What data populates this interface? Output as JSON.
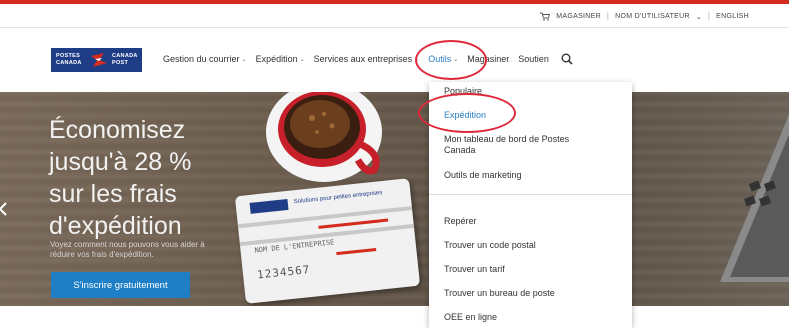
{
  "utility": {
    "shop": "MAGASINER",
    "username": "NOM D'UTILISATEUR",
    "username_caret": "⌄",
    "language": "ENGLISH",
    "separator": "|"
  },
  "logo": {
    "left_line1": "POSTES",
    "left_line2": "CANADA",
    "right_line1": "CANADA",
    "right_line2": "POST"
  },
  "menu": {
    "items": [
      {
        "label": "Gestion du courrier",
        "caret": "⌄"
      },
      {
        "label": "Expédition",
        "caret": "⌄"
      },
      {
        "label": "Services aux entreprises",
        "caret": "⌄"
      },
      {
        "label": "Outils",
        "caret": "⌄"
      },
      {
        "label": "Magasiner",
        "caret": ""
      },
      {
        "label": "Soutien",
        "caret": ""
      }
    ]
  },
  "hero": {
    "headline_line1": "Économisez",
    "headline_line2": "jusqu'à 28 %",
    "headline_line3": "sur les frais",
    "headline_line4": "d'expédition",
    "subtext": "Voyez comment nous pouvons vous aider à réduire vos frais d'expédition.",
    "cta": "S'inscrire gratuitement",
    "card_title": "Solutions pour petites entreprises",
    "card_name": "NOM DE L'ENTREPRISE",
    "card_digits": "1234567"
  },
  "dropdown": {
    "group1": [
      "Populaire",
      "Expédition",
      "Mon tableau de bord de Postes Canada",
      "Outils de marketing"
    ],
    "group2": [
      "Repérer",
      "Trouver un code postal",
      "Trouver un tarif",
      "Trouver un bureau de poste",
      "OEE en ligne"
    ]
  },
  "colors": {
    "brand_red": "#d52b1e",
    "brand_blue": "#1f3d87",
    "link_blue": "#2a7fc4",
    "annotation_red": "#e0283a"
  }
}
